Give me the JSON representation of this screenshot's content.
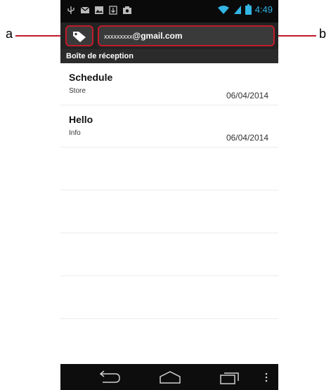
{
  "status_bar": {
    "time": "4:49"
  },
  "action_bar": {
    "tag_button_icon": "tag-icon",
    "account_masked": "xxxxxxxxx",
    "account_domain": "@gmail.com"
  },
  "folder": {
    "name": "Boîte de réception"
  },
  "messages": [
    {
      "subject": "Schedule",
      "sender": "Store",
      "date": "06/04/2014"
    },
    {
      "subject": "Hello",
      "sender": "Info",
      "date": "06/04/2014"
    }
  ],
  "callouts": {
    "a": "a",
    "b": "b"
  },
  "colors": {
    "accent_time": "#33b5e5",
    "callout_red": "#c01c2b"
  }
}
